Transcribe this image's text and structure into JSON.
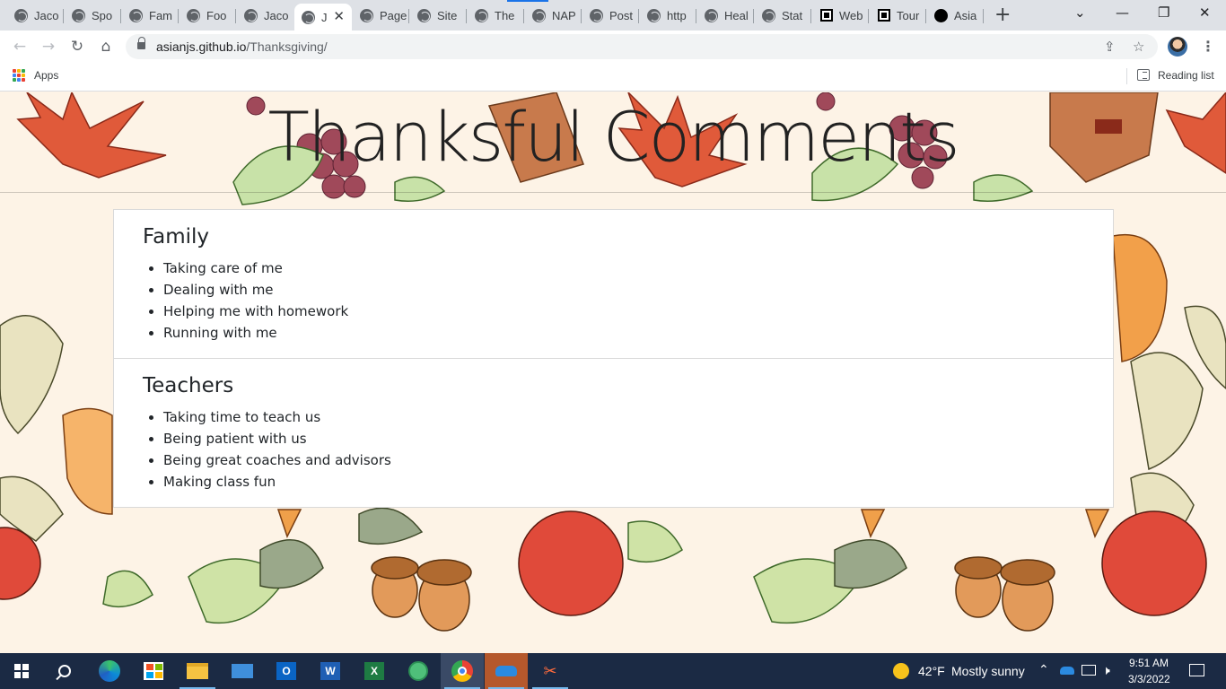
{
  "browser": {
    "tabs": [
      {
        "label": "Jaco",
        "icon": "globe-icon"
      },
      {
        "label": "Spo",
        "icon": "globe-icon"
      },
      {
        "label": "Fam",
        "icon": "globe-icon"
      },
      {
        "label": "Foo",
        "icon": "globe-icon"
      },
      {
        "label": "Jaco",
        "icon": "globe-icon"
      },
      {
        "label": "J",
        "icon": "globe-icon",
        "active": true
      },
      {
        "label": "Page",
        "icon": "globe-icon"
      },
      {
        "label": "Site",
        "icon": "globe-icon"
      },
      {
        "label": "The",
        "icon": "globe-icon"
      },
      {
        "label": "NAP",
        "icon": "globe-icon"
      },
      {
        "label": "Post",
        "icon": "globe-icon"
      },
      {
        "label": "http",
        "icon": "globe-icon"
      },
      {
        "label": "Heal",
        "icon": "globe-icon"
      },
      {
        "label": "Stat",
        "icon": "globe-icon"
      },
      {
        "label": "Web",
        "icon": "square-logo-icon"
      },
      {
        "label": "Tour",
        "icon": "square-logo-icon"
      },
      {
        "label": "Asia",
        "icon": "github-icon"
      }
    ],
    "url_host": "asianjs.github.io",
    "url_path": "/Thanksgiving/",
    "bookmarks": {
      "apps_label": "Apps",
      "reading_list_label": "Reading list"
    }
  },
  "page": {
    "title": "Thanksful Comments",
    "sections": [
      {
        "heading": "Family",
        "items": [
          "Taking care of me",
          "Dealing with me",
          "Helping me with homework",
          "Running with me"
        ]
      },
      {
        "heading": "Teachers",
        "items": [
          "Taking time to teach us",
          "Being patient with us",
          "Being great coaches and advisors",
          "Making class fun"
        ]
      }
    ]
  },
  "taskbar": {
    "apps": [
      "start-icon",
      "search-icon",
      "edge-icon",
      "store-icon",
      "file-explorer-icon",
      "mail-icon",
      "outlook-icon",
      "word-icon",
      "excel-icon",
      "atom-icon",
      "chrome-icon",
      "onedrive-icon",
      "snip-icon"
    ],
    "weather_temp": "42°F",
    "weather_text": "Mostly sunny",
    "time": "9:51 AM",
    "date": "3/3/2022"
  },
  "colors": {
    "tab_strip": "#dee1e6",
    "taskbar": "#1b2a44",
    "page_bg": "#fdf3e6",
    "chrome_blue": "#1a73e8"
  }
}
